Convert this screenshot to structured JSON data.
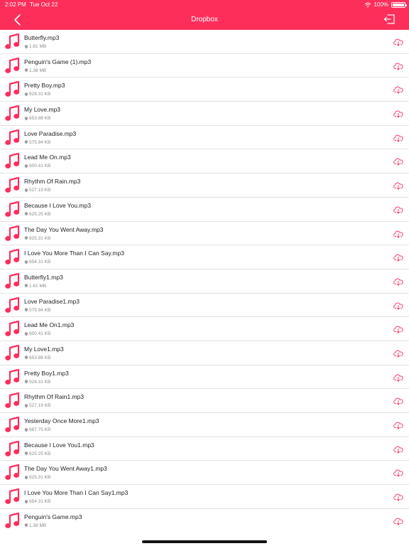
{
  "status_bar": {
    "time": "2:02 PM",
    "date": "Tue Oct 22",
    "battery": "100%"
  },
  "nav": {
    "title": "Dropbox",
    "back_icon": "chevron-left-icon",
    "logout_icon": "logout-icon"
  },
  "colors": {
    "accent": "#fe2e5b",
    "divider": "#e3e3e3",
    "secondary_text": "#8a8a8a"
  },
  "files": [
    {
      "name": "Butterfly.mp3",
      "size": "1.61 MB"
    },
    {
      "name": "Penguin's Game (1).mp3",
      "size": "1.38 MB"
    },
    {
      "name": "Pretty Boy.mp3",
      "size": "928.31 KB"
    },
    {
      "name": "My Love.mp3",
      "size": "653.88 KB"
    },
    {
      "name": "Love Paradise.mp3",
      "size": "575.94 KB"
    },
    {
      "name": "Lead Me On.mp3",
      "size": "600.41 KB"
    },
    {
      "name": "Rhythm Of Rain.mp3",
      "size": "527.19 KB"
    },
    {
      "name": "Because I Love You.mp3",
      "size": "625.25 KB"
    },
    {
      "name": "The Day You Went Away.mp3",
      "size": "825.31 KB"
    },
    {
      "name": "I Love You More Than I Can Say.mp3",
      "size": "654.31 KB"
    },
    {
      "name": "Butterfly1.mp3",
      "size": "1.61 MB"
    },
    {
      "name": "Love Paradise1.mp3",
      "size": "575.94 KB"
    },
    {
      "name": "Lead Me On1.mp3",
      "size": "600.41 KB"
    },
    {
      "name": "My Love1.mp3",
      "size": "653.88 KB"
    },
    {
      "name": "Pretty Boy1.mp3",
      "size": "928.31 KB"
    },
    {
      "name": "Rhythm Of Rain1.mp3",
      "size": "527.19 KB"
    },
    {
      "name": "Yesterday Once More1.mp3",
      "size": "687.75 KB"
    },
    {
      "name": "Because I Love You1.mp3",
      "size": "625.25 KB"
    },
    {
      "name": "The Day You Went Away1.mp3",
      "size": "825.31 KB"
    },
    {
      "name": "I Love You More Than I Can Say1.mp3",
      "size": "654.31 KB"
    },
    {
      "name": "Penguin's Game.mp3",
      "size": "1.38 MB"
    }
  ]
}
